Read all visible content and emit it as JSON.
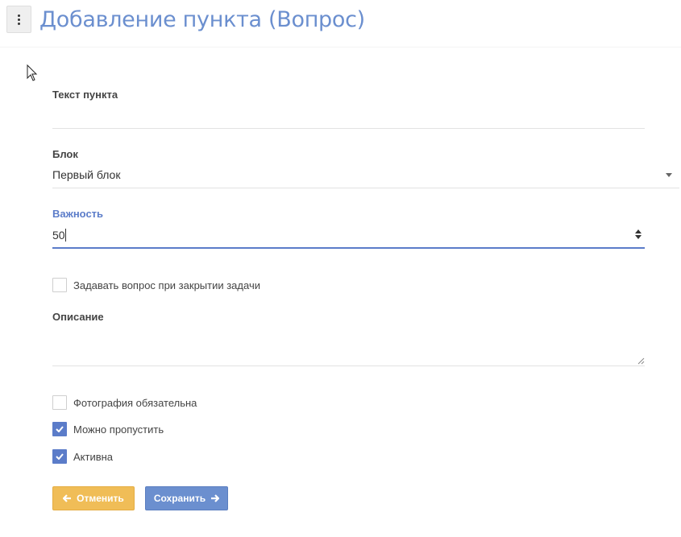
{
  "header": {
    "title": "Добавление пункта (Вопрос)",
    "menu_icon": "kebab-menu-icon"
  },
  "form": {
    "item_text": {
      "label": "Текст пункта",
      "value": ""
    },
    "block": {
      "label": "Блок",
      "value": "Первый блок"
    },
    "importance": {
      "label": "Важность",
      "value": "50"
    },
    "ask_on_close": {
      "label": "Задавать вопрос при закрытии задачи",
      "checked": false
    },
    "description": {
      "label": "Описание",
      "value": ""
    },
    "photo_required": {
      "label": "Фотография обязательна",
      "checked": false
    },
    "can_skip": {
      "label": "Можно пропустить",
      "checked": true
    },
    "active": {
      "label": "Активна",
      "checked": true
    }
  },
  "buttons": {
    "cancel": "Отменить",
    "save": "Сохранить"
  },
  "colors": {
    "accent": "#6b8fcf",
    "warning": "#f0bd57",
    "title": "#6b8fcf"
  }
}
